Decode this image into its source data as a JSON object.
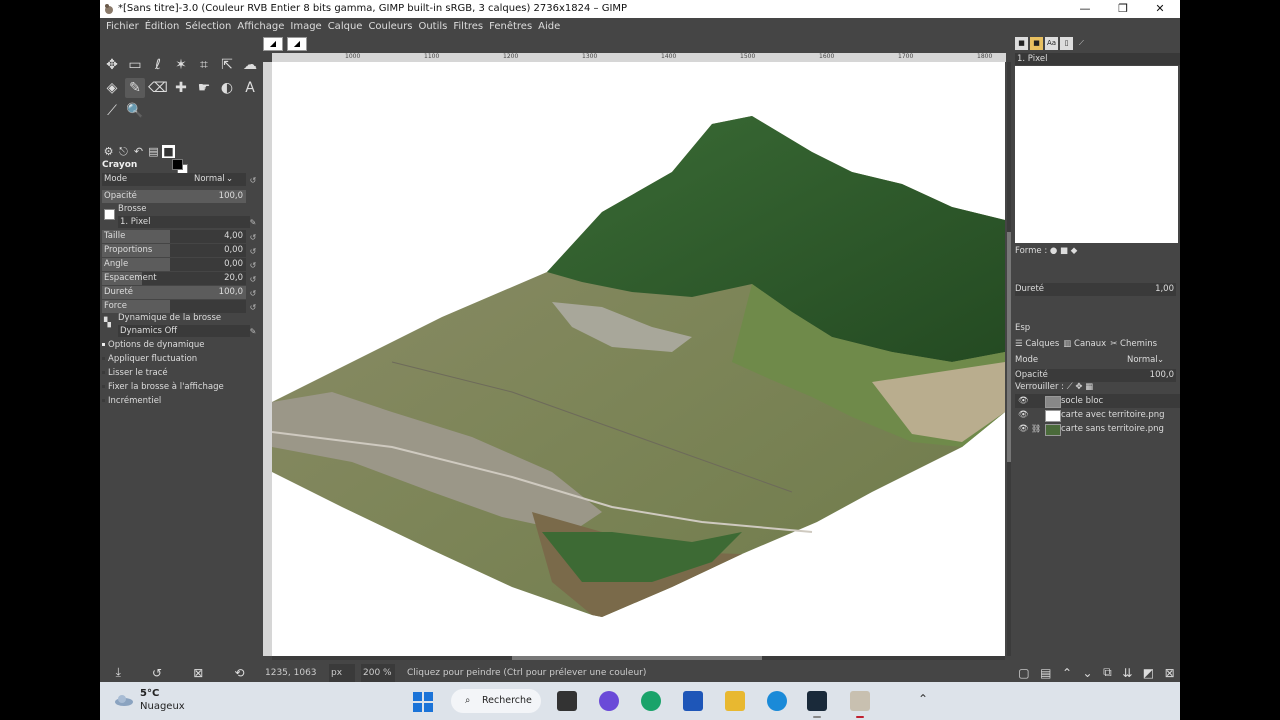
{
  "window": {
    "title": "*[Sans titre]-3.0 (Couleur RVB Entier 8 bits gamma, GIMP built-in sRGB, 3 calques) 2736x1824 – GIMP",
    "controls": {
      "minimize": "—",
      "maximize": "❐",
      "close": "✕"
    }
  },
  "menu": [
    "Fichier",
    "Édition",
    "Sélection",
    "Affichage",
    "Image",
    "Calque",
    "Couleurs",
    "Outils",
    "Filtres",
    "Fenêtres",
    "Aide"
  ],
  "toolbox": {
    "tools_row1": [
      "move-icon",
      "rect-select-icon",
      "lasso-icon",
      "fuzzy-select-icon",
      "crop-icon",
      "transform-icon",
      "warp-icon"
    ],
    "tools_row2": [
      "bucket-fill-icon",
      "pencil-icon",
      "eraser-icon",
      "heal-icon",
      "smudge-icon",
      "dodge-icon",
      "text-icon"
    ],
    "tools_row3": [
      "color-picker-icon",
      "zoom-icon"
    ],
    "tool_glyphs_row1": [
      "✥",
      "▭",
      "ℓ",
      "✶",
      "⌗",
      "⇱",
      "☁"
    ],
    "tool_glyphs_row2": [
      "◈",
      "✎",
      "⌫",
      "✚",
      "☛",
      "◐",
      "A"
    ],
    "tool_glyphs_row3": [
      "⟋",
      "🔍"
    ],
    "options": {
      "title": "Crayon",
      "mode_label": "Mode",
      "mode_value": "Normal",
      "opacity_label": "Opacité",
      "opacity_value": "100,0",
      "brush_label": "Brosse",
      "brush_value": "1. Pixel",
      "size_label": "Taille",
      "size_value": "4,00",
      "proportions_label": "Proportions",
      "proportions_value": "0,00",
      "angle_label": "Angle",
      "angle_value": "0,00",
      "spacing_label": "Espacement",
      "spacing_value": "20,0",
      "hardness_label": "Dureté",
      "hardness_value": "100,0",
      "force_label": "Force",
      "dynamics_label": "Dynamique de la brosse",
      "dynamics_value": "Dynamics Off",
      "dyn_options_label": "Options de dynamique",
      "apply_jitter_label": "Appliquer fluctuation",
      "smooth_label": "Lisser le tracé",
      "lock_brush_label": "Fixer la brosse à l'affichage",
      "incremental_label": "Incrémentiel"
    }
  },
  "canvas": {
    "ruler_ticks": [
      "1000",
      "1100",
      "1200",
      "1300",
      "1400",
      "1500",
      "1600",
      "1700",
      "1800"
    ],
    "status": {
      "coords": "1235, 1063",
      "unit": "px",
      "zoom": "200 %",
      "message": "Cliquez pour peindre (Ctrl pour prélever une couleur)"
    }
  },
  "dock": {
    "brush_name": "1. Pixel",
    "shape_label": "Forme :",
    "hardness_label": "Dureté",
    "hardness_value": "1,00",
    "spacing_label": "Esp",
    "tabs": {
      "layers": "Calques",
      "channels": "Canaux",
      "paths": "Chemins"
    },
    "mode_label": "Mode",
    "mode_value": "Normal",
    "opacity_label": "Opacité",
    "opacity_value": "100,0",
    "lock_label": "Verrouiller :",
    "layers": [
      {
        "name": "socle bloc"
      },
      {
        "name": "carte avec territoire.png"
      },
      {
        "name": "carte sans territoire.png"
      }
    ]
  },
  "taskbar": {
    "temperature": "5°C",
    "weather": "Nuageux",
    "search_label": "Recherche"
  },
  "colors": {
    "gimp_bg": "#454545",
    "forest": "#2f5a2a",
    "fields": "#8a8a5a",
    "taskbar": "#dde3ea"
  }
}
